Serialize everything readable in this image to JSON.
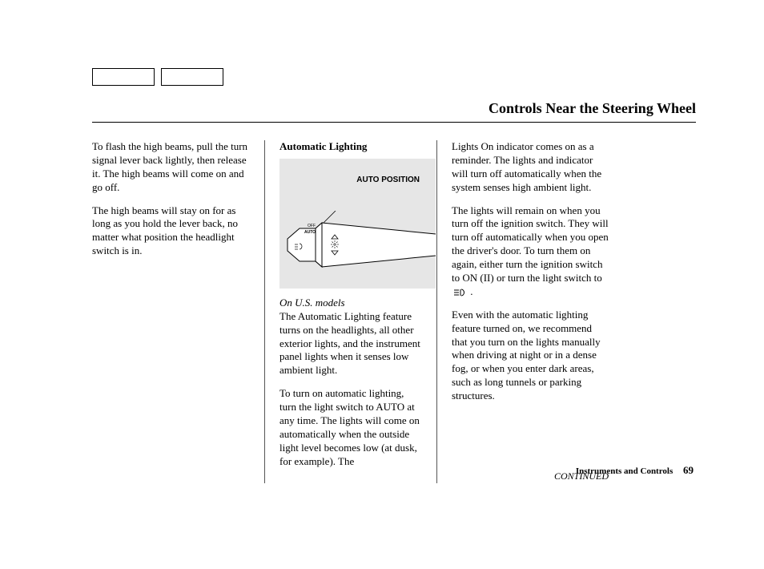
{
  "heading": "Controls Near the Steering Wheel",
  "col1": {
    "p1": "To flash the high beams, pull the turn signal lever back lightly, then release it. The high beams will come on and go off.",
    "p2": "The high beams will stay on for as long as you hold the lever back, no matter what position the headlight switch is in."
  },
  "col2": {
    "subhead": "Automatic Lighting",
    "diagram_label": "AUTO POSITION",
    "note": "On U.S. models",
    "p1": "The Automatic Lighting feature turns on the headlights, all other exterior lights, and the instrument panel lights when it senses low ambient light.",
    "p2": "To turn on automatic lighting, turn the light switch to AUTO at any time. The lights will come on automatically when the outside light level becomes low (at dusk, for example). The"
  },
  "col3": {
    "p1": "Lights On indicator comes on as a reminder. The lights and indicator will turn off automatically when the system senses high ambient light.",
    "p2_a": "The lights will remain on when you turn off the ignition switch. They will turn off automatically when you open the driver's door. To turn them on again, either turn the ignition switch to ON (II) or turn the light switch to ",
    "p2_b": " .",
    "p3": "Even with the automatic lighting feature turned on, we recommend that you turn on the lights manually when driving at night or in a dense fog, or when you enter dark areas, such as long tunnels or parking structures.",
    "continued": "CONTINUED"
  },
  "footer": {
    "section": "Instruments and Controls",
    "page": "69"
  }
}
